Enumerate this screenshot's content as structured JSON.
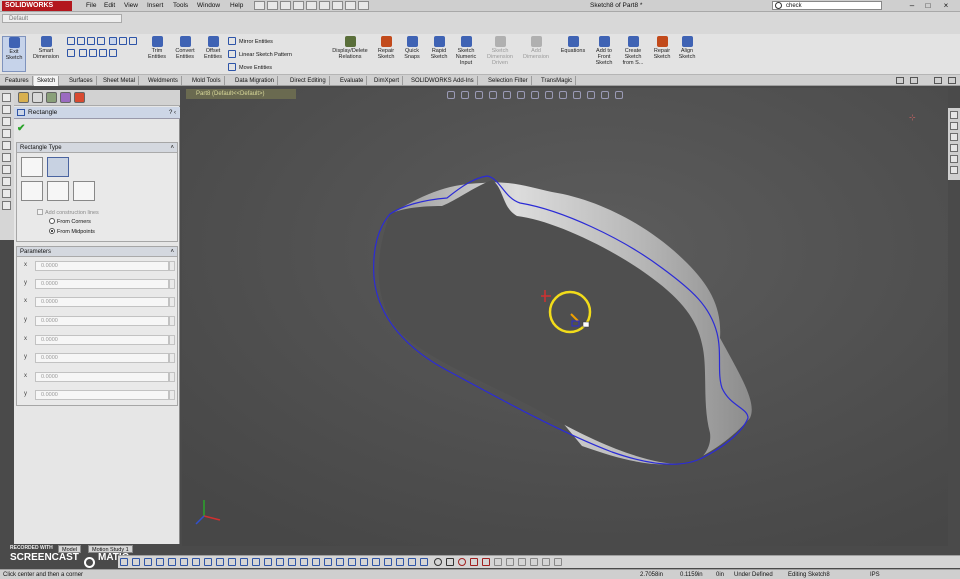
{
  "app": {
    "logo": "SOLIDWORKS",
    "menu": [
      "File",
      "Edit",
      "View",
      "Insert",
      "Tools",
      "Window",
      "Help"
    ],
    "document_title": "Sketch8 of Part8 *",
    "search_value": "check",
    "configuration": "Default"
  },
  "ribbon": {
    "buttons": [
      {
        "label": "Exit Sketch"
      },
      {
        "label": "Smart Dimension"
      },
      {
        "label": "Trim Entities"
      },
      {
        "label": "Convert Entities"
      },
      {
        "label": "Offset Entities"
      },
      {
        "label": "Mirror Entities"
      },
      {
        "label": "Linear Sketch Pattern"
      },
      {
        "label": "Move Entities"
      },
      {
        "label": "Display/Delete Relations"
      },
      {
        "label": "Repair Sketch"
      },
      {
        "label": "Quick Snaps"
      },
      {
        "label": "Rapid Sketch"
      },
      {
        "label": "Sketch Numeric Input"
      },
      {
        "label": "Sketch Dimension Driven"
      },
      {
        "label": "Add Dimension"
      },
      {
        "label": "Equations"
      },
      {
        "label": "Add to Front Sketch"
      },
      {
        "label": "Create Sketch from S..."
      },
      {
        "label": "Repair Sketch"
      },
      {
        "label": "Align Sketch"
      }
    ]
  },
  "tabs": [
    "Features",
    "Sketch",
    "Surfaces",
    "Sheet Metal",
    "Weldments",
    "Mold Tools",
    "Data Migration",
    "Direct Editing",
    "Evaluate",
    "DimXpert",
    "SOLIDWORKS Add-Ins",
    "Selection Filter",
    "TransMagic"
  ],
  "property_manager": {
    "title": "Rectangle",
    "rectangle_type_header": "Rectangle Type",
    "add_construction_lines": "Add construction lines",
    "option_corners": "From Corners",
    "option_midpoints": "From Midpoints",
    "parameters_header": "Parameters",
    "parameters": [
      {
        "axis": "x",
        "value": "0.0000"
      },
      {
        "axis": "y",
        "value": "0.0000"
      },
      {
        "axis": "x",
        "value": "0.0000"
      },
      {
        "axis": "y",
        "value": "0.0000"
      },
      {
        "axis": "x",
        "value": "0.0000"
      },
      {
        "axis": "y",
        "value": "0.0000"
      },
      {
        "axis": "x",
        "value": "0.0000"
      },
      {
        "axis": "y",
        "value": "0.0000"
      }
    ]
  },
  "viewport": {
    "tree_flyout": "Part8 (Default<<Default>)",
    "sketch_color": "#2b2bd6"
  },
  "bottom": {
    "model_tab": "Model",
    "motion_tab": "Motion Study 1",
    "recorded_label": "RECORDED WITH",
    "screencast": "SCREENCAST",
    "matic": "MATIC"
  },
  "status": {
    "message": "Click center and then a corner",
    "x": "2.7058in",
    "y": "0.1159in",
    "z": "0in",
    "state": "Under Defined",
    "mode": "Editing Sketch8",
    "units": "IPS"
  }
}
